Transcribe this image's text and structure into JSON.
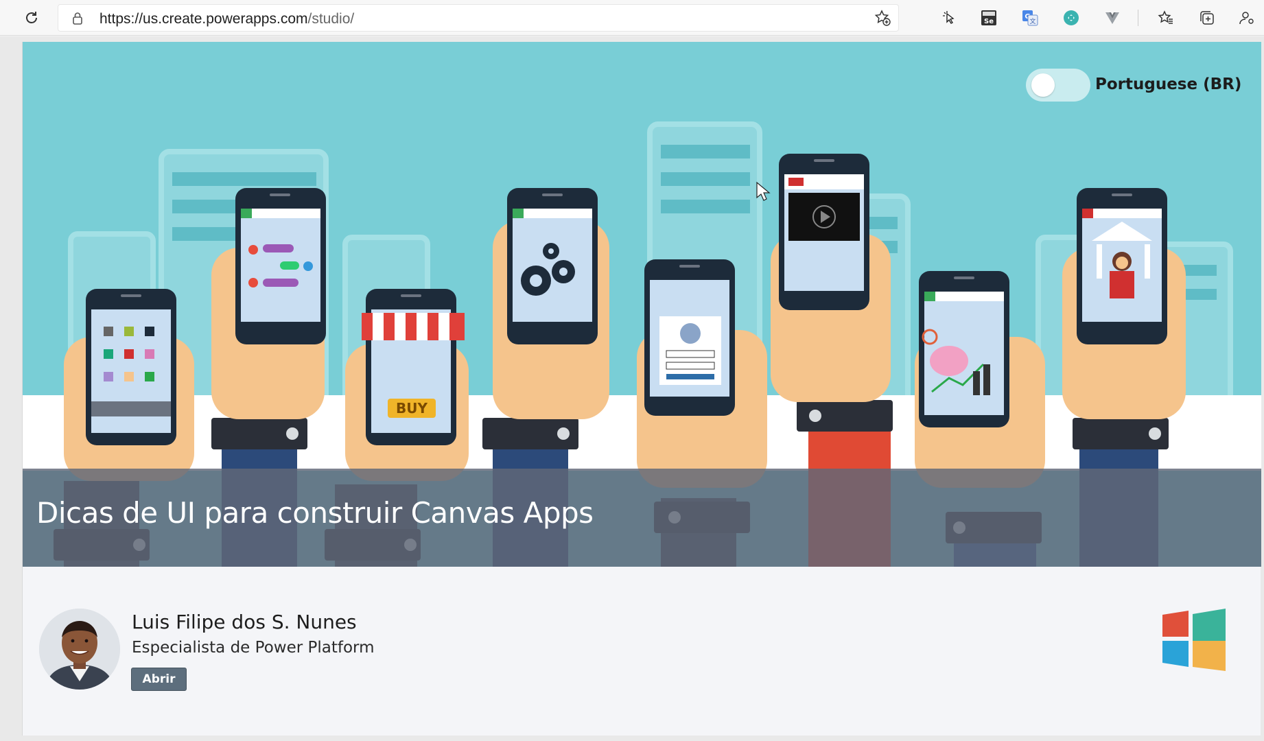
{
  "browser": {
    "url_host": "https://us.create.powerapps.com",
    "url_path": "/studio/",
    "icons": [
      "refresh-icon",
      "lock-icon",
      "favorite-add-icon",
      "cursor-extension-icon",
      "selenium-extension-icon",
      "translate-extension-icon",
      "extension-icon",
      "vue-extension-icon",
      "favorites-icon",
      "collections-icon",
      "profile-icon"
    ]
  },
  "banner": {
    "language_label": "Portuguese (BR)",
    "title": "Dicas de UI para construir Canvas Apps",
    "buy_label": "BUY"
  },
  "author": {
    "name": "Luis Filipe dos S. Nunes",
    "role": "Especialista de Power Platform",
    "open_button": "Abrir"
  },
  "colors": {
    "banner_bg": "#79ced6",
    "overlay": "#606878",
    "button": "#5d6e7d"
  }
}
